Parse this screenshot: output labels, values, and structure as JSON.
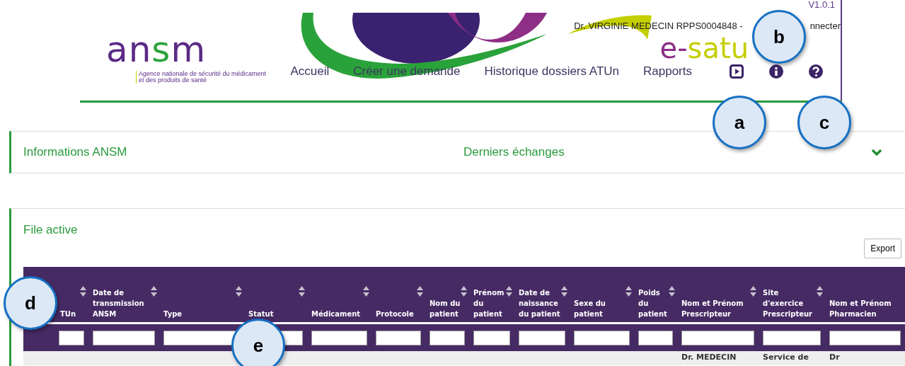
{
  "version": "V1.0.1",
  "user": {
    "name": "Dr. VIRGINIE MEDECIN RPPS0004848  -",
    "logout": "nnecter"
  },
  "logo": {
    "name": "ansm",
    "tagline": [
      "Agence nationale de sécurité du médicament",
      "et des produits de santé"
    ]
  },
  "app_logo": {
    "prefix": "e-",
    "accent": "sa",
    "rest": "tu"
  },
  "nav": [
    {
      "label": "Accueil"
    },
    {
      "label": "Créer une demande"
    },
    {
      "label": "Historique dossiers ATUn"
    },
    {
      "label": "Rapports"
    }
  ],
  "nav_icons": [
    {
      "kind": "play"
    },
    {
      "kind": "info"
    },
    {
      "kind": "help"
    }
  ],
  "callouts": [
    {
      "label": "a"
    },
    {
      "label": "b"
    },
    {
      "label": "c"
    },
    {
      "label": "d"
    },
    {
      "label": "e"
    }
  ],
  "panel": {
    "title": "Informations ANSM",
    "subtitle": "Derniers échanges",
    "expanded": false
  },
  "file_active": {
    "title": "File active",
    "export": "Export",
    "columns": [
      {
        "label": "TUn",
        "sortable": true
      },
      {
        "label": "Date de transmission ANSM",
        "sortable": true
      },
      {
        "label": "Type",
        "sortable": true
      },
      {
        "label": "Statut",
        "sortable": true
      },
      {
        "label": "Médicament",
        "sortable": true
      },
      {
        "label": "Protocole",
        "sortable": true
      },
      {
        "label": "Nom du patient",
        "sortable": true
      },
      {
        "label": "Prénom du patient",
        "sortable": true
      },
      {
        "label": "Date de naissance du patient",
        "sortable": true
      },
      {
        "label": "Sexe du patient",
        "sortable": true
      },
      {
        "label": "Poids du patient",
        "sortable": true
      },
      {
        "label": "Nom et Prénom Prescripteur",
        "sortable": true
      },
      {
        "label": "Site d'exercice Prescripteur",
        "sortable": true
      },
      {
        "label": "Nom et Prénom Pharmacien",
        "sortable": false
      }
    ],
    "rows": [
      {
        "prescripteur": "Dr. MEDECIN",
        "site_prescripteur": "Service de",
        "pharmacien": "Dr"
      }
    ]
  }
}
